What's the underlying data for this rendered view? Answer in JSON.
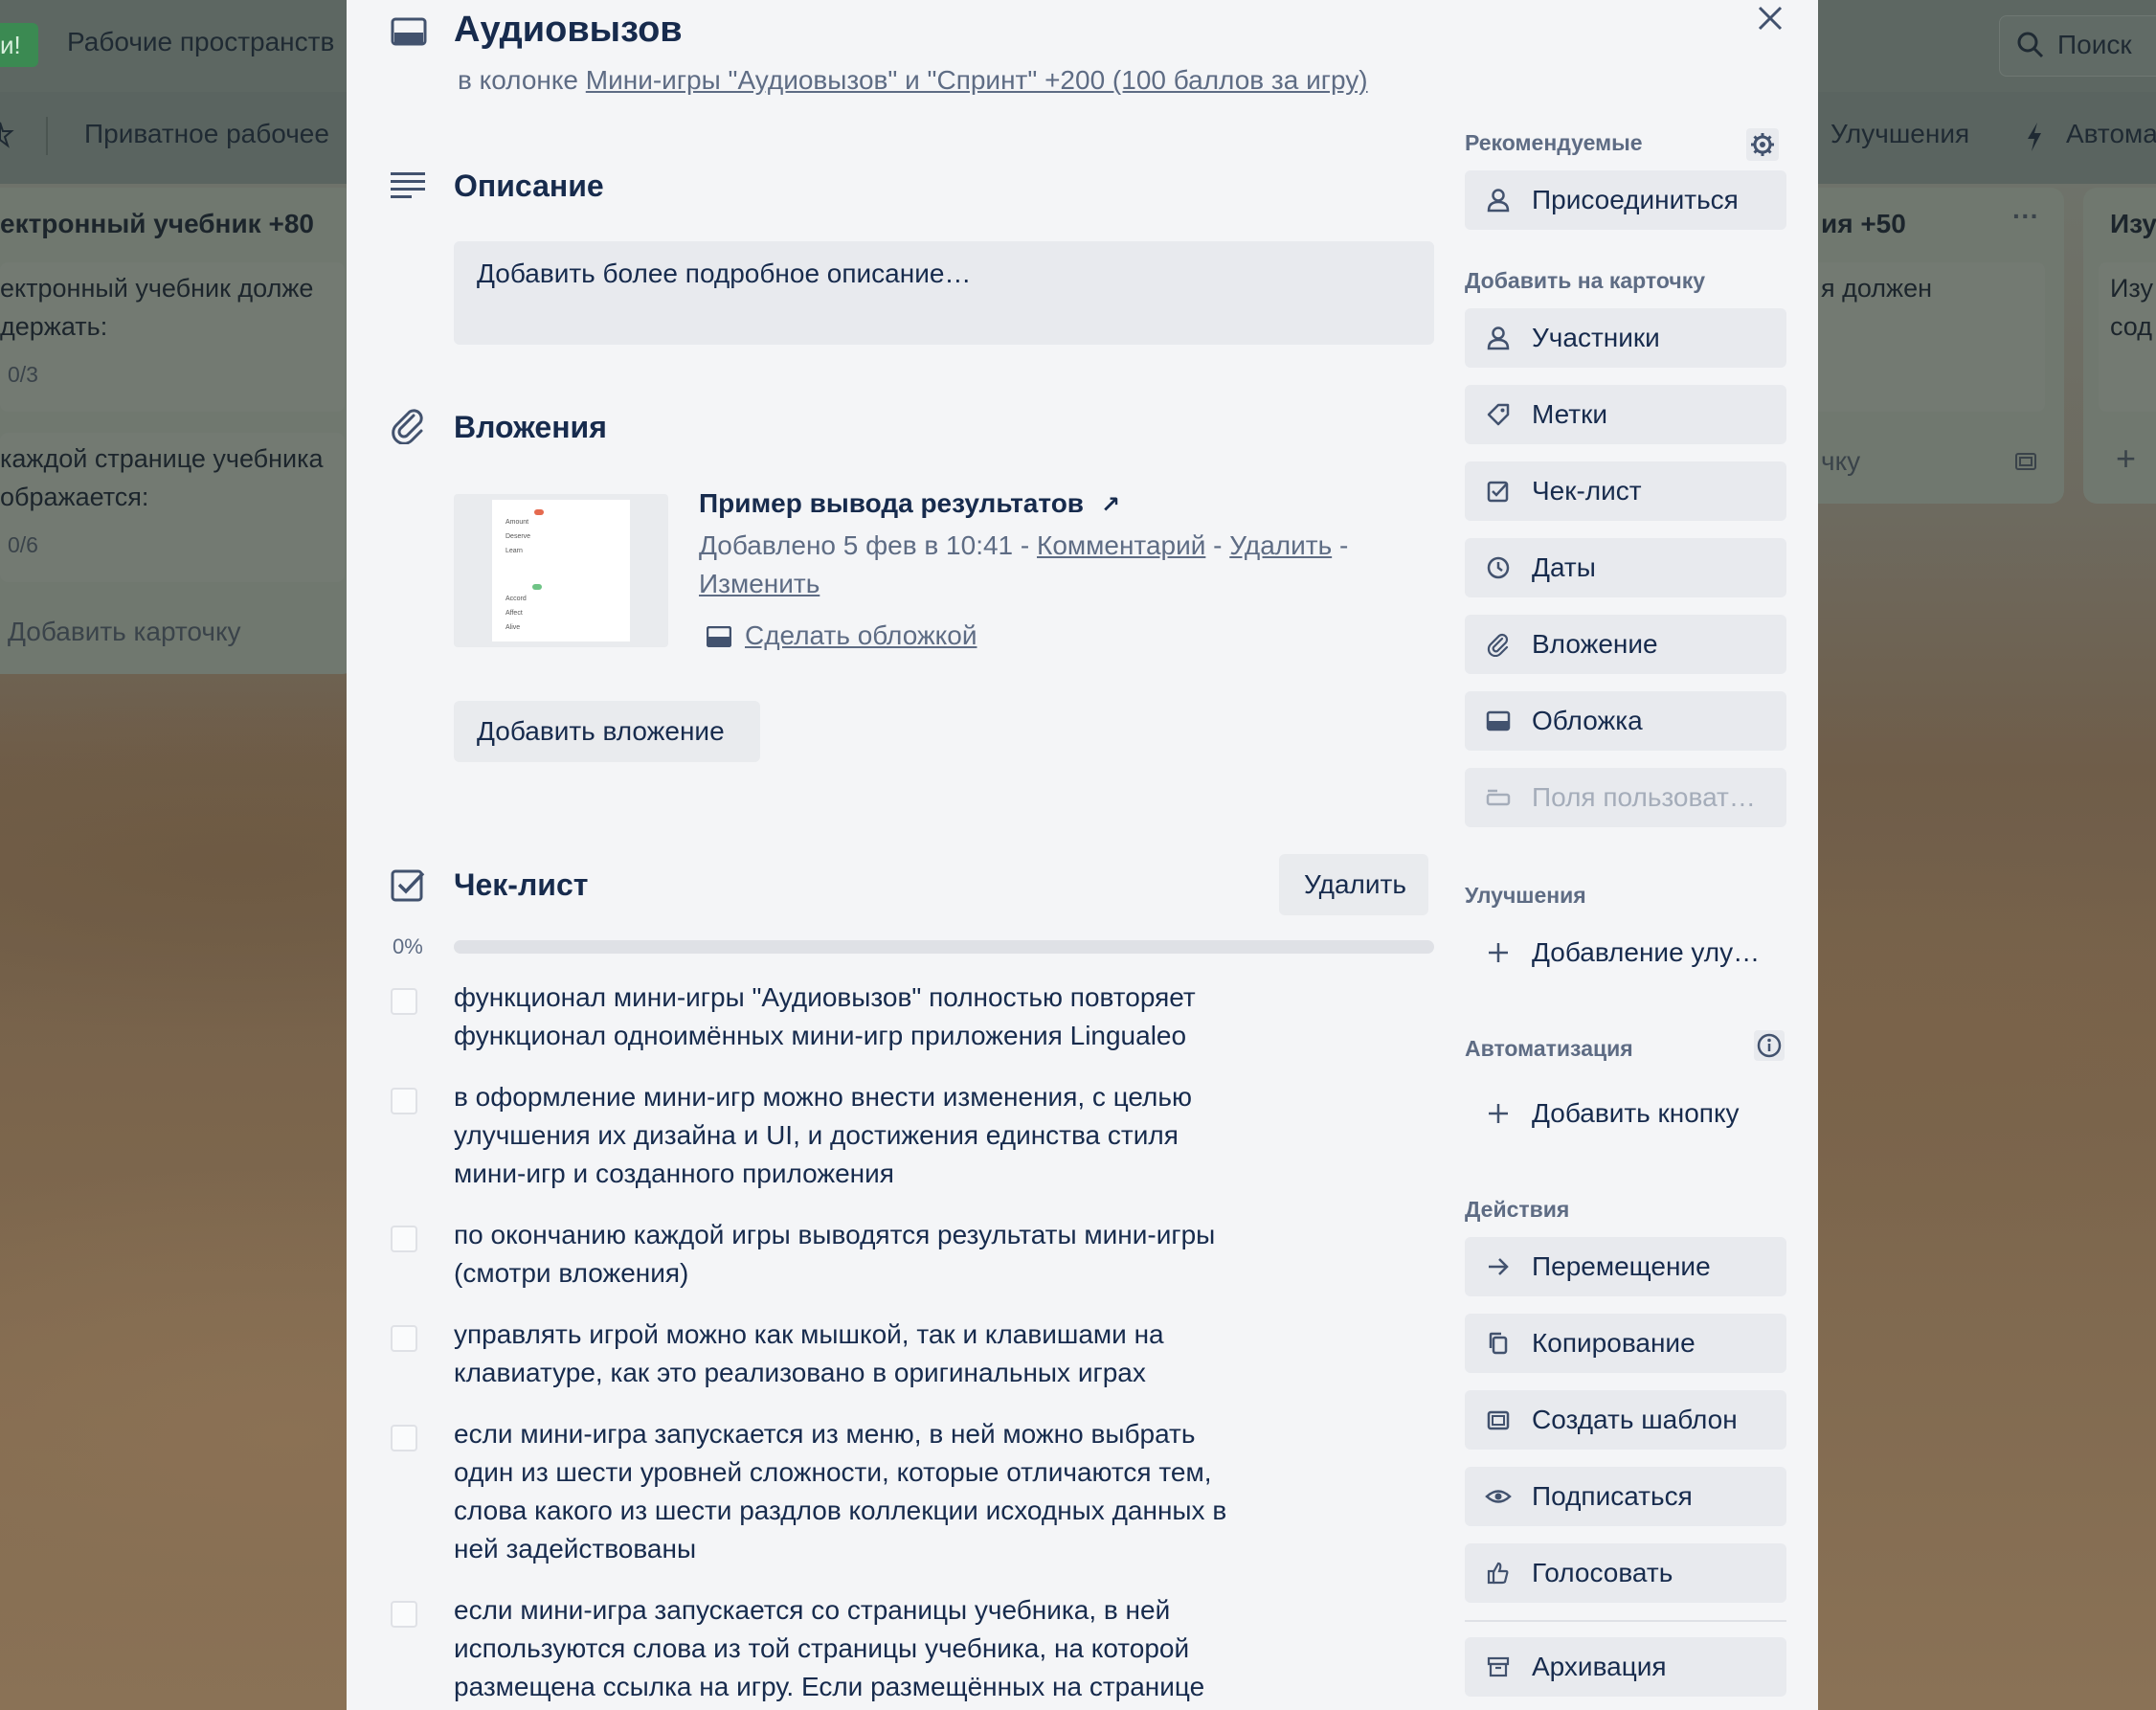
{
  "background": {
    "top_left_badge": "и!",
    "workspaces": "Рабочие пространств",
    "search": "Поиск",
    "private_workspace": "Приватное рабочее",
    "improvements_tab": "Улучшения",
    "automation_tab": "Автома",
    "left_list": {
      "title": "ектронный учебник +80",
      "card1_line1": "ектронный учебник долже",
      "card1_line2": "держать:",
      "card1_count": "0/3",
      "card2_line1": "каждой странице учебника",
      "card2_line2": "ображается:",
      "card2_count": "0/6",
      "add_card": "Добавить карточку"
    },
    "right_list": {
      "title": "ия +50",
      "card_text": "я должен",
      "add_card": "чку"
    },
    "far_right_list": {
      "title": "Изу",
      "line1": "Изу",
      "line2": "сод"
    }
  },
  "card": {
    "title": "Аудиовызов",
    "in_column_prefix": "в колонке",
    "column_name": "Мини-игры \"Аудиовызов\" и \"Спринт\" +200 (100 баллов за игру)"
  },
  "description": {
    "heading": "Описание",
    "placeholder": "Добавить более подробное описание…"
  },
  "attachments": {
    "heading": "Вложения",
    "item": {
      "name": "Пример вывода результатов",
      "arrow": "↗",
      "added": "Добавлено 5 фев в 10:41",
      "sep": " - ",
      "comment": "Комментарий",
      "delete": "Удалить",
      "edit": "Изменить",
      "make_cover": "Сделать обложкой"
    },
    "add_button": "Добавить вложение"
  },
  "checklist": {
    "heading": "Чек-лист",
    "delete_button": "Удалить",
    "progress_label": "0%",
    "progress": 0,
    "items": [
      {
        "line1": "функционал мини-игры \"Аудиовызов\" полностью повторяет",
        "line2": "функционал одноимённых мини-игр приложения Lingualeo",
        "line3": "",
        "line4": ""
      },
      {
        "line1": "в оформление мини-игр можно внести изменения, с целью",
        "line2": "улучшения их дизайна и UI, и достижения единства стиля",
        "line3": "мини-игр и созданного приложения",
        "line4": ""
      },
      {
        "line1": "по окончанию каждой игры выводятся результаты мини-игры",
        "line2": "(смотри вложения)",
        "line3": "",
        "line4": ""
      },
      {
        "line1": "управлять игрой можно как мышкой, так и клавишами на",
        "line2": "клавиатуре, как это реализовано в оригинальных играх",
        "line3": "",
        "line4": ""
      },
      {
        "line1": "если мини-игра запускается из меню, в ней можно выбрать",
        "line2": "один из шести уровней сложности, которые отличаются тем,",
        "line3": "слова какого из шести раздлов коллекции исходных данных в",
        "line4": "ней задействованы"
      },
      {
        "line1": "если мини-игра запускается со страницы учебника, в ней",
        "line2": "используются слова из той страницы учебника, на которой",
        "line3": "размещена ссылка на игру. Если размещённых на странице",
        "line4": ""
      }
    ]
  },
  "sidebar": {
    "recommended": "Рекомендуемые",
    "join": "Присоединиться",
    "add_to_card": "Добавить на карточку",
    "members": "Участники",
    "labels": "Метки",
    "checklist": "Чек-лист",
    "dates": "Даты",
    "attachment": "Вложение",
    "cover": "Обложка",
    "custom_fields": "Поля пользоват…",
    "powerups": "Улучшения",
    "add_powerup": "Добавление улу…",
    "automation": "Автоматизация",
    "add_button": "Добавить кнопку",
    "actions": "Действия",
    "move": "Перемещение",
    "copy": "Копирование",
    "make_template": "Создать шаблон",
    "watch": "Подписаться",
    "vote": "Голосовать",
    "archive": "Архивация"
  },
  "thumbnail": {
    "label1": "Amount",
    "label2": "Deserve",
    "label3": "Learn",
    "label4": "Accord",
    "label5": "Affect",
    "label6": "Alive"
  }
}
